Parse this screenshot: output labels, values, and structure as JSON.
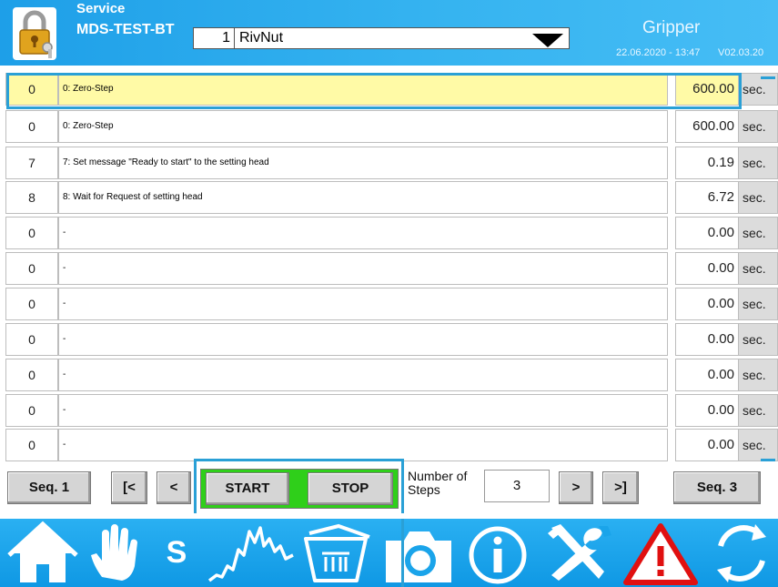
{
  "header": {
    "title": "Service",
    "device": "MDS-TEST-BT",
    "sequence_number": "1",
    "sequence_name": "RivNut",
    "machine": "Gripper",
    "datetime": "22.06.2020 - 13:47",
    "version": "V02.03.20"
  },
  "current_step": {
    "num": "0",
    "desc": "0: Zero-Step",
    "time": "600.00",
    "unit": "sec."
  },
  "steps": [
    {
      "num": "0",
      "desc": "0: Zero-Step",
      "time": "600.00",
      "unit": "sec."
    },
    {
      "num": "7",
      "desc": "7: Set message \"Ready to start\" to the setting head",
      "time": "0.19",
      "unit": "sec."
    },
    {
      "num": "8",
      "desc": "8: Wait for Request of setting head",
      "time": "6.72",
      "unit": "sec."
    },
    {
      "num": "0",
      "desc": "-",
      "time": "0.00",
      "unit": "sec."
    },
    {
      "num": "0",
      "desc": "-",
      "time": "0.00",
      "unit": "sec."
    },
    {
      "num": "0",
      "desc": "-",
      "time": "0.00",
      "unit": "sec."
    },
    {
      "num": "0",
      "desc": "-",
      "time": "0.00",
      "unit": "sec."
    },
    {
      "num": "0",
      "desc": "-",
      "time": "0.00",
      "unit": "sec."
    },
    {
      "num": "0",
      "desc": "-",
      "time": "0.00",
      "unit": "sec."
    },
    {
      "num": "0",
      "desc": "-",
      "time": "0.00",
      "unit": "sec."
    }
  ],
  "controls": {
    "seq_prev": "Seq. 1",
    "first": "[<",
    "prev": "<",
    "start": "START",
    "stop": "STOP",
    "steps_label": "Number of Steps",
    "steps_value": "3",
    "next": ">",
    "last": ">]",
    "seq_next": "Seq. 3"
  },
  "nav": {
    "items": [
      "home-icon",
      "hand-icon",
      "s-icon",
      "signal-chart-icon",
      "archive-box-icon",
      "camera-icon",
      "info-icon",
      "tools-icon",
      "warning-icon",
      "refresh-icon"
    ],
    "s_label": "S"
  },
  "colors": {
    "header_blue": "#1e9fe8",
    "selected_row": "#fffaa6",
    "frame_blue": "#2aa0d6",
    "start_green": "#2fcf1a",
    "warning_red": "#e01010"
  }
}
